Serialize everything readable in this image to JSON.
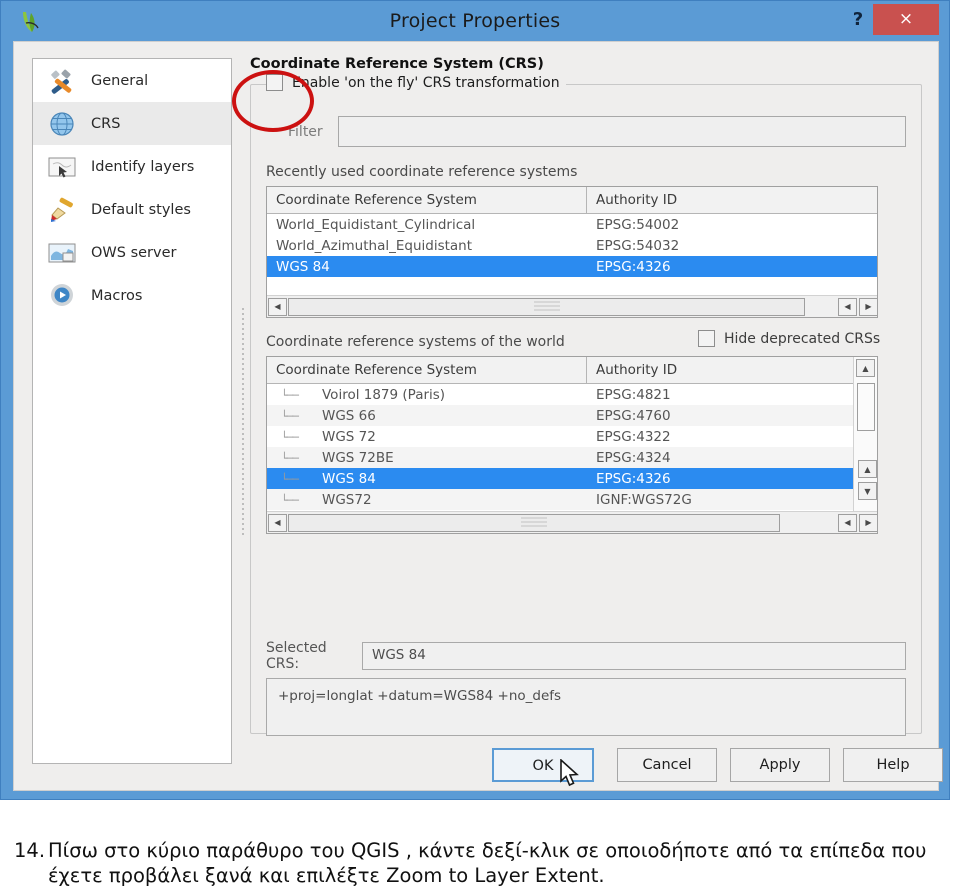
{
  "window": {
    "title": "Project Properties",
    "app_icon": "qgis-logo-icon",
    "help_label": "?",
    "close_label": "×"
  },
  "sidebar": {
    "items": [
      {
        "label": "General",
        "icon": "tools-icon",
        "selected": false
      },
      {
        "label": "CRS",
        "icon": "globe-icon",
        "selected": true
      },
      {
        "label": "Identify layers",
        "icon": "identify-map-icon",
        "selected": false
      },
      {
        "label": "Default styles",
        "icon": "paintbrush-icon",
        "selected": false
      },
      {
        "label": "OWS server",
        "icon": "ows-map-icon",
        "selected": false
      },
      {
        "label": "Macros",
        "icon": "gear-play-icon",
        "selected": false
      }
    ]
  },
  "crs_panel": {
    "title": "Coordinate Reference System (CRS)",
    "enable_checkbox_label": "Enable 'on the fly' CRS transformation",
    "enable_checked": false,
    "filter_label": "Filter",
    "filter_value": "",
    "filter_placeholder": "",
    "recent_label": "Recently used coordinate reference systems",
    "world_label": "Coordinate reference systems of the world",
    "hide_deprecated_label": "Hide deprecated CRSs",
    "hide_deprecated_checked": false,
    "columns": [
      "Coordinate Reference System",
      "Authority ID"
    ],
    "recent_rows": [
      {
        "name": "World_Equidistant_Cylindrical",
        "authority": "EPSG:54002",
        "selected": false
      },
      {
        "name": "World_Azimuthal_Equidistant",
        "authority": "EPSG:54032",
        "selected": false
      },
      {
        "name": "WGS 84",
        "authority": "EPSG:4326",
        "selected": true
      }
    ],
    "world_rows": [
      {
        "name": "Voirol 1879 (Paris)",
        "authority": "EPSG:4821",
        "selected": false
      },
      {
        "name": "WGS 66",
        "authority": "EPSG:4760",
        "selected": false
      },
      {
        "name": "WGS 72",
        "authority": "EPSG:4322",
        "selected": false
      },
      {
        "name": "WGS 72BE",
        "authority": "EPSG:4324",
        "selected": false
      },
      {
        "name": "WGS 84",
        "authority": "EPSG:4326",
        "selected": true
      },
      {
        "name": "WGS72",
        "authority": "IGNF:WGS72G",
        "selected": false
      }
    ],
    "selected_crs_label": "Selected CRS:",
    "selected_crs_value": "WGS 84",
    "proj_string": "+proj=longlat +datum=WGS84 +no_defs"
  },
  "buttons": [
    {
      "label": "OK",
      "default": true
    },
    {
      "label": "Cancel",
      "default": false
    },
    {
      "label": "Apply",
      "default": false
    },
    {
      "label": "Help",
      "default": false
    }
  ],
  "annotation": {
    "shape": "red-ellipse",
    "color": "#cc1111",
    "target": "enable-on-the-fly-crs-checkbox"
  },
  "caption": {
    "number": "14.",
    "text": "Πίσω στο κύριο παράθυρο του QGIS , κάντε δεξί-κλικ σε οποιοδήποτε από τα επίπεδα που έχετε προβάλει ξανά και επιλέξτε Zoom to Layer Extent."
  },
  "colors": {
    "titlebar": "#5b9bd5",
    "close_button": "#c9514f",
    "selection": "#2b8bf0",
    "annotation": "#cc1111"
  }
}
